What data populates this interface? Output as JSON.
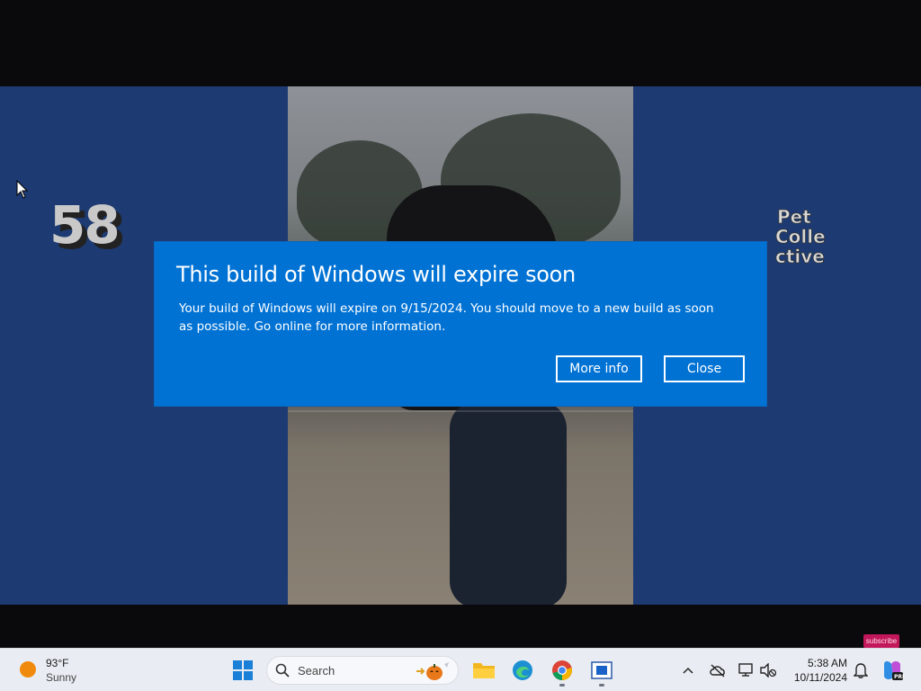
{
  "video": {
    "counter": "58",
    "brand_name": "Pet Collective",
    "subscribe_label": "subscribe"
  },
  "dialog": {
    "title": "This build of Windows will expire soon",
    "message": "Your build of Windows will expire on 9/15/2024. You should move to a new build as soon as possible. Go online for more information.",
    "more_info_label": "More info",
    "close_label": "Close"
  },
  "taskbar": {
    "weather": {
      "temperature": "93°F",
      "condition": "Sunny"
    },
    "search_placeholder": "Search",
    "clock": {
      "time": "5:38 AM",
      "date": "10/11/2024"
    },
    "pinned_apps": [
      "File Explorer",
      "Microsoft Edge",
      "Google Chrome",
      "Windows Sandbox"
    ]
  },
  "colors": {
    "dialog_background": "#0072d4",
    "taskbar_background": "#e9edf3",
    "video_side_background": "#1d3b72"
  }
}
